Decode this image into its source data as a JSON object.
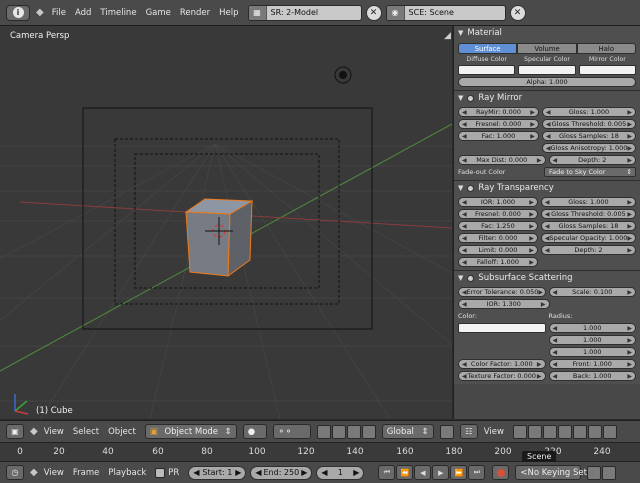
{
  "topbar": {
    "menus": [
      "File",
      "Add",
      "Timeline",
      "Game",
      "Render",
      "Help"
    ],
    "screen_field": "SR: 2-Model",
    "scene_field": "SCE: Scene",
    "close_glyph": "✕"
  },
  "viewport": {
    "view_label": "Camera Persp",
    "object_label": "(1) Cube"
  },
  "material": {
    "header": "Material",
    "tabs": [
      "Surface",
      "Volume",
      "Halo"
    ],
    "active_tab": "Surface",
    "color_labels": [
      "Diffuse Color",
      "Specular Color",
      "Mirror Color"
    ],
    "alpha": "Alpha: 1.000"
  },
  "ray_mirror": {
    "header": "Ray Mirror",
    "left": [
      "RayMir: 0.000",
      "Fresnel: 0.000",
      "Fac: 1.000"
    ],
    "right": [
      "Gloss: 1.000",
      "Gloss Threshold: 0.005",
      "Gloss Samples: 18",
      "Gloss Anisotropy: 1.000"
    ],
    "max_dist": "Max Dist: 0.000",
    "depth": "Depth: 2",
    "fade_label": "Fade-out Color",
    "fade_value": "Fade to Sky Color"
  },
  "ray_transparency": {
    "header": "Ray Transparency",
    "left": [
      "IOR: 1.000",
      "Fresnel: 0.000",
      "Fac: 1.250",
      "Filter: 0.000",
      "Limit: 0.000",
      "Falloff: 1.000"
    ],
    "right": [
      "Gloss: 1.000",
      "Gloss Threshold: 0.005",
      "Gloss Samples: 18",
      "Specular Opacity: 1.000",
      "Depth: 2"
    ]
  },
  "sss": {
    "header": "Subsurface Scattering",
    "error_tolerance": "Error Tolerance: 0.050",
    "scale": "Scale: 0.100",
    "ior": "IOR: 1.300",
    "color_label": "Color:",
    "radius_label": "Radius:",
    "radius": [
      "1.000",
      "1.000",
      "1.000"
    ],
    "color_factor": "Color Factor: 1.000",
    "front": "Front: 1.000",
    "texture_factor": "Texture Factor: 0.000",
    "back": "Back: 1.000"
  },
  "view_header": {
    "menus": [
      "View",
      "Select",
      "Object"
    ],
    "mode": "Object Mode",
    "orientation": "Global",
    "props_view": "View"
  },
  "timeline": {
    "ticks": [
      "0",
      "20",
      "40",
      "60",
      "80",
      "100",
      "120",
      "140",
      "160",
      "180",
      "200",
      "220",
      "240"
    ],
    "menus": [
      "View",
      "Frame",
      "Playback"
    ],
    "pr": "PR",
    "start": "Start: 1",
    "end": "End: 250",
    "current": "1",
    "keying": "<No Keying Set>",
    "tooltip": "Scene"
  }
}
